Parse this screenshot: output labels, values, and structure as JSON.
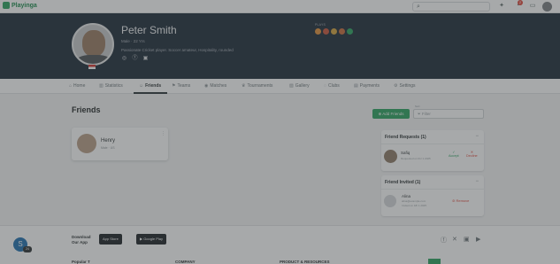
{
  "app": {
    "logo_text": "Playinga"
  },
  "topbar": {
    "search_icon": "search-icon",
    "notification_count": "2"
  },
  "profile": {
    "name": "Peter Smith",
    "meta": "Male · 22 Yrs",
    "bio": "Passionate Cricket player. Soccer amateur, Hospitality, rounded",
    "plays_label": "PLAYS",
    "sports_colors": [
      "#e2913a",
      "#c9543a",
      "#d4a33c",
      "#c96b3a",
      "#2aa35f"
    ]
  },
  "tabs": [
    {
      "label": "Home"
    },
    {
      "label": "Statistics"
    },
    {
      "label": "Friends"
    },
    {
      "label": "Teams"
    },
    {
      "label": "Matches"
    },
    {
      "label": "Tournaments"
    },
    {
      "label": "Gallery"
    },
    {
      "label": "Clubs"
    },
    {
      "label": "Payments"
    },
    {
      "label": "Settings"
    }
  ],
  "friends": {
    "title": "Friends",
    "add_button": "Add Friends",
    "filter_label": "Sort",
    "filter_placeholder": "Filter",
    "list": [
      {
        "name": "Henry",
        "sub": "Male · US"
      }
    ]
  },
  "requests": {
    "title": "Friend Requests (1)",
    "items": [
      {
        "name": "Safiq",
        "sub": "Requested on 01/ 1 2025",
        "accept": "Accept",
        "decline": "Decline"
      }
    ]
  },
  "invited": {
    "title": "Friend Invited (1)",
    "items": [
      {
        "name": "Alina",
        "email": "alina@example.com",
        "sub": "Invited on 18/ 1 2025",
        "remove": "Remove"
      }
    ]
  },
  "footer": {
    "download": "Download Our App",
    "app_store": "App Store",
    "google_play": "Google Play",
    "chat_badge": "24",
    "col_company": "COMPANY",
    "col_resources": "PRODUCT & RESOURCES",
    "col_first": "Popular T"
  },
  "colors": {
    "brand": "#2aa35f",
    "hero": "#1d2a38",
    "danger": "#e0473b"
  }
}
